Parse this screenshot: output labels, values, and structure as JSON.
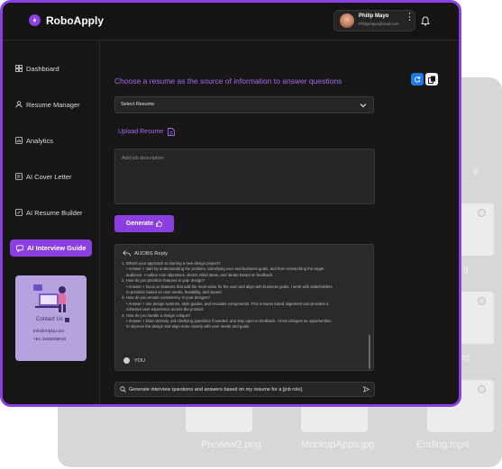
{
  "app": {
    "name": "RoboApply",
    "user": {
      "name": "Philip Mayo",
      "email": "Philipmayo@mail.com"
    }
  },
  "sidebar": {
    "items": [
      {
        "label": "Dashboard"
      },
      {
        "label": "Resume  Manager"
      },
      {
        "label": "Analytics"
      },
      {
        "label": "AI Cover Letter"
      },
      {
        "label": "AI Resume Builder"
      },
      {
        "label": "AI Interview Guide"
      }
    ],
    "promo": {
      "contact": "Contact Us",
      "email": "info@mlybj.com",
      "phone": "+91 3335209610"
    }
  },
  "main": {
    "heading": "Choose a resume as the source of information to answer questions",
    "select_value": "Select Resume",
    "upload_label": "Upload Resume",
    "jd_placeholder": "Add job description",
    "generate_label": "Generate",
    "reply": {
      "title": "AIJOBS Reply",
      "lines": [
        {
          "text": "1. What's your approach to starting a new design project?",
          "indent": false
        },
        {
          "text": "• Answer: I start by understanding the problem, identifying user and business goals, and then researching the target",
          "indent": true
        },
        {
          "text": "audience. I outline core objectives, sketch initial ideas, and iterate based on feedback.",
          "indent": true
        },
        {
          "text": "2. How do you prioritize features in your design?",
          "indent": false
        },
        {
          "text": "• Answer: I focus on features that add the most value for the user and align with business goals. I work with stakeholders",
          "indent": true
        },
        {
          "text": "to prioritize based on user needs, feasibility, and impact.",
          "indent": true
        },
        {
          "text": "3. How do you ensure consistency in your designs?",
          "indent": false
        },
        {
          "text": "• Answer: I use design systems, style guides, and reusable components. This ensures brand alignment and provides a",
          "indent": true
        },
        {
          "text": "cohesive user experience across the product.",
          "indent": true
        },
        {
          "text": "4. How do you handle a design critique?",
          "indent": false
        },
        {
          "text": "• Answer: I listen actively, ask clarifying questions if needed, and stay open to feedback. I treat critiques as opportunities",
          "indent": true
        },
        {
          "text": "to improve the design and align more closely with user needs and goals.",
          "indent": true
        }
      ],
      "you_label": "YOU"
    },
    "prompt_text": "Generate interview questions and answers based on my resume for a [job role]."
  },
  "background": {
    "files": [
      "Preview2.png",
      "MockupApps.jpg",
      "Ending.mp4"
    ],
    "ghost_labels": [
      "g",
      "pg"
    ]
  },
  "colors": {
    "accent": "#8b3fe0",
    "accent_text": "#a767f0",
    "bg": "#171717",
    "blue": "#1f7ae6"
  }
}
